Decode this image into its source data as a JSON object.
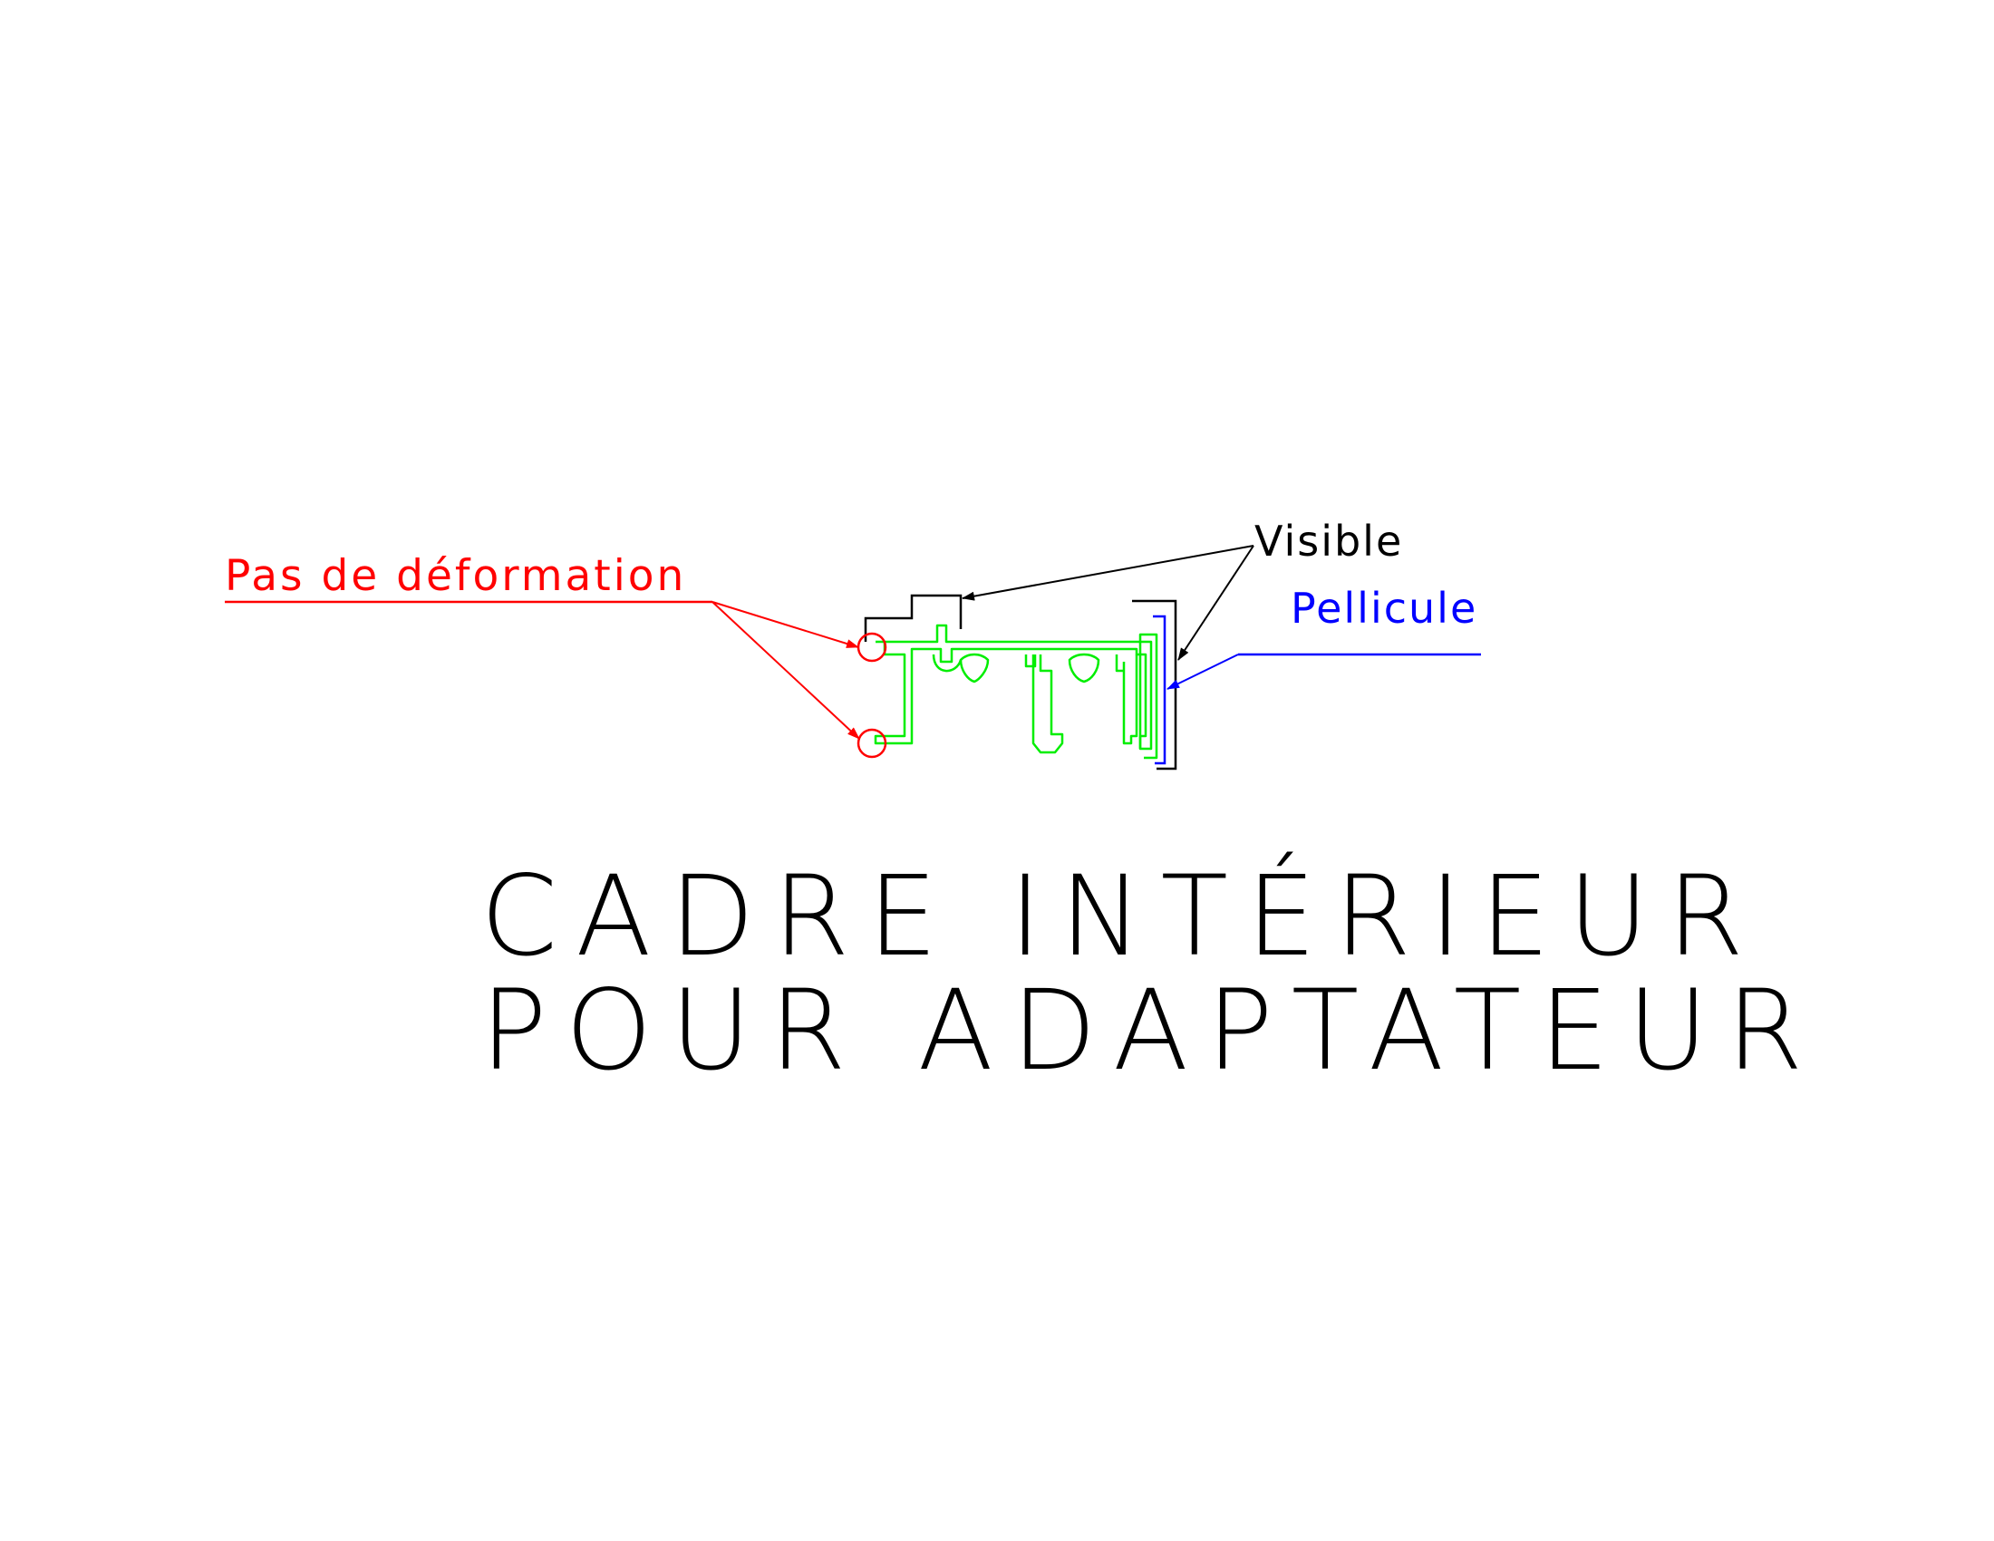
{
  "labels": {
    "deformation": "Pas de déformation",
    "visible": "Visible",
    "film": "Pellicule"
  },
  "title": {
    "line1": "CADRE INTÉRIEUR",
    "line2": "POUR ADAPTATEUR"
  },
  "colors": {
    "profile": "#00ee00",
    "annotation_red": "#ff0000",
    "annotation_black": "#000000",
    "annotation_blue": "#0000ff"
  }
}
